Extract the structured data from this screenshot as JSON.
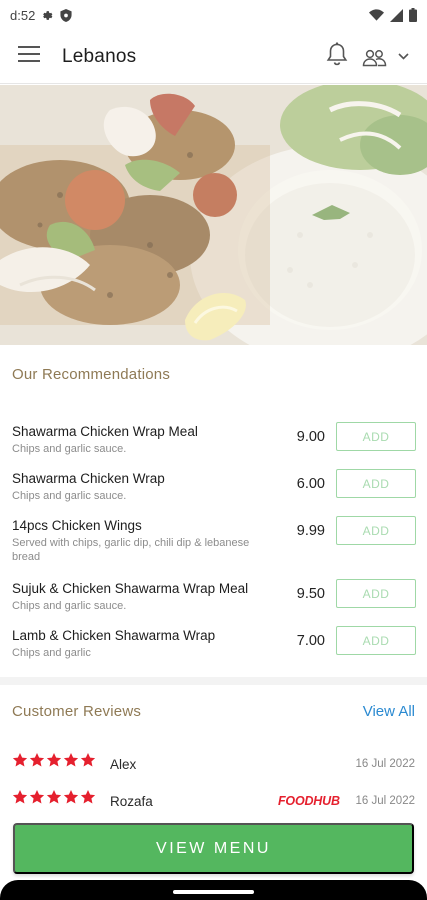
{
  "status_bar": {
    "time": "d:52"
  },
  "header": {
    "title": "Lebanos"
  },
  "recommendations": {
    "title": "Our Recommendations",
    "add_label": "ADD",
    "items": [
      {
        "name": "Shawarma Chicken Wrap Meal",
        "description": "Chips and garlic sauce.",
        "price": "9.00"
      },
      {
        "name": "Shawarma Chicken Wrap",
        "description": "Chips and garlic sauce.",
        "price": "6.00"
      },
      {
        "name": "14pcs Chicken Wings",
        "description": "Served with chips, garlic dip, chili dip & lebanese bread",
        "price": "9.99"
      },
      {
        "name": "Sujuk & Chicken Shawarma Wrap Meal",
        "description": "Chips and garlic sauce.",
        "price": "9.50"
      },
      {
        "name": "Lamb & Chicken Shawarma Wrap",
        "description": "Chips and garlic",
        "price": "7.00"
      }
    ]
  },
  "reviews": {
    "title": "Customer Reviews",
    "view_all": "View All",
    "items": [
      {
        "name": "Alex",
        "date": "16 Jul 2022",
        "rating": 5,
        "source": ""
      },
      {
        "name": "Rozafa",
        "date": "16 Jul 2022",
        "rating": 5,
        "source": "FOODHUB"
      }
    ]
  },
  "cta": {
    "label": "VIEW MENU"
  },
  "colors": {
    "accent_green": "#54b75f",
    "section_title": "#8f7a55",
    "link_blue": "#2b8ad1",
    "star_red": "#e5202e"
  }
}
